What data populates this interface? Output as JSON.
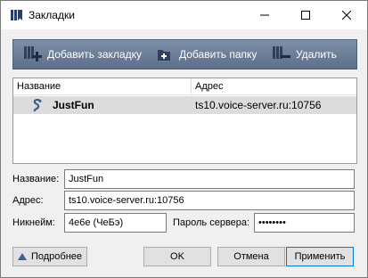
{
  "window": {
    "title": "Закладки",
    "controls": [
      "minimize-icon",
      "maximize-icon",
      "close-icon"
    ]
  },
  "toolbar": {
    "add_bookmark": "Добавить закладку",
    "add_folder": "Добавить папку",
    "delete": "Удалить"
  },
  "list": {
    "columns": [
      "Название",
      "Адрес"
    ],
    "rows": [
      {
        "name": "JustFun",
        "address": "ts10.voice-server.ru:10756",
        "icon": "bookmark-icon"
      }
    ]
  },
  "form": {
    "name_label": "Название:",
    "name_value": "JustFun",
    "address_label": "Адрес:",
    "address_value": "ts10.voice-server.ru:10756",
    "nickname_label": "Никнейм:",
    "nickname_value": "4e6e (ЧеБэ)",
    "password_label": "Пароль сервера:",
    "password_value": "••••••••"
  },
  "buttons": {
    "more": "Подробнее",
    "ok": "OK",
    "cancel": "Отмена",
    "apply": "Применить"
  },
  "colors": {
    "toolbar": "#6a7b97",
    "selected_row": "#dcdcdc",
    "dialog_bg": "#f0f0f0",
    "default_button_border": "#0078d7"
  }
}
